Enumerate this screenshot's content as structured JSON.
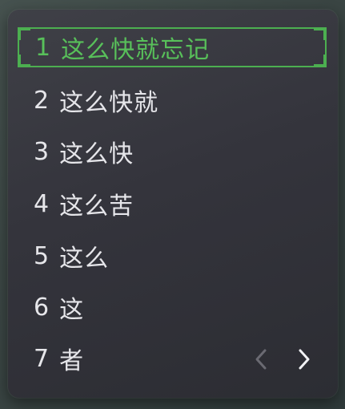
{
  "candidate_window": {
    "candidates": [
      {
        "index": "1",
        "text": "这么快就忘记",
        "selected": true
      },
      {
        "index": "2",
        "text": "这么快就",
        "selected": false
      },
      {
        "index": "3",
        "text": "这么快",
        "selected": false
      },
      {
        "index": "4",
        "text": "这么苦",
        "selected": false
      },
      {
        "index": "5",
        "text": "这么",
        "selected": false
      },
      {
        "index": "6",
        "text": "这",
        "selected": false
      },
      {
        "index": "7",
        "text": "者",
        "selected": false
      }
    ],
    "prev_page_icon": "chevron-left-icon",
    "next_page_icon": "chevron-right-icon",
    "colors": {
      "selected": "#4caf50",
      "text": "#e6e6ea",
      "prev_disabled": "#6a6a72",
      "next_enabled": "#f2f2f5"
    }
  }
}
